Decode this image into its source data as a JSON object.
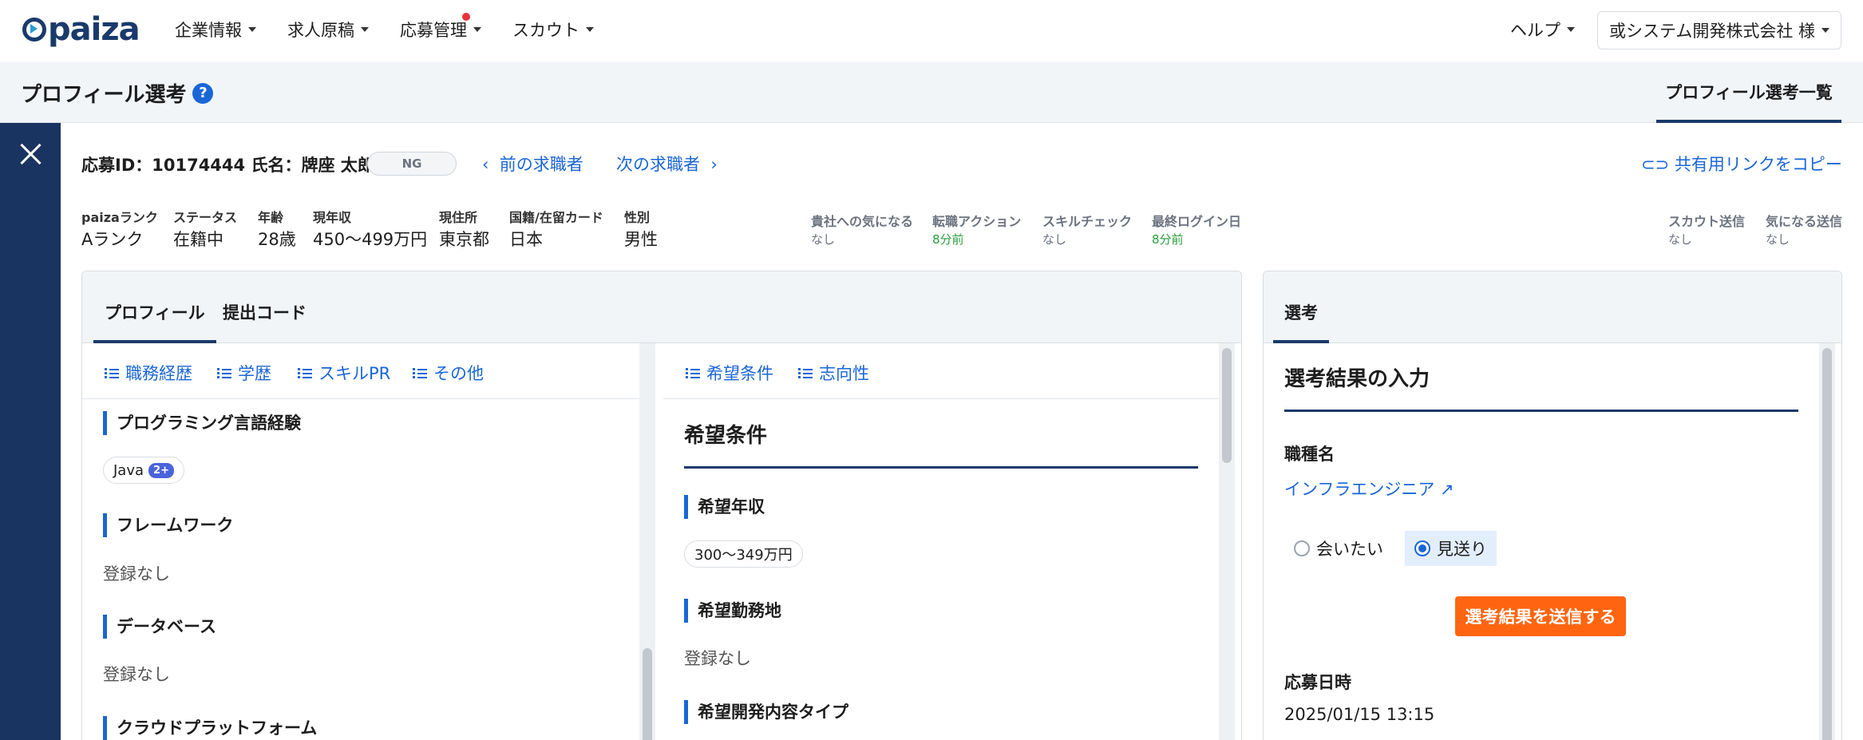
{
  "brand": {
    "name": "paiza"
  },
  "nav": {
    "items": [
      {
        "label": "企業情報"
      },
      {
        "label": "求人原稿"
      },
      {
        "label": "応募管理"
      },
      {
        "label": "スカウト"
      }
    ],
    "help": "ヘルプ",
    "company": "或システム開発株式会社 様"
  },
  "page": {
    "title": "プロフィール選考",
    "tab": "プロフィール選考一覧"
  },
  "applicant": {
    "id_name": "応募ID：10174444  氏名：牌座 太郎",
    "status_badge": "NG",
    "prev": "前の求職者",
    "next": "次の求職者",
    "copy_link": "共有用リンクをコピー"
  },
  "info": [
    {
      "label": "paizaランク",
      "value": "Aランク"
    },
    {
      "label": "ステータス",
      "value": "在籍中"
    },
    {
      "label": "年齢",
      "value": "28歳"
    },
    {
      "label": "現年収",
      "value": "450〜499万円"
    },
    {
      "label": "現住所",
      "value": "東京都"
    },
    {
      "label": "国籍/在留カード",
      "value": "日本"
    },
    {
      "label": "性別",
      "value": "男性"
    }
  ],
  "activity": [
    {
      "label": "貴社への気になる",
      "value": "なし"
    },
    {
      "label": "転職アクション",
      "value": "8分前"
    },
    {
      "label": "スキルチェック",
      "value": "なし"
    },
    {
      "label": "最終ログイン日",
      "value": "8分前"
    },
    {
      "label": "スカウト送信",
      "value": "なし"
    },
    {
      "label": "気になる送信",
      "value": "なし"
    }
  ],
  "profile_panel": {
    "tabs": [
      "プロフィール",
      "提出コード"
    ],
    "left_nav": [
      "職務経歴",
      "学歴",
      "スキルPR",
      "その他"
    ],
    "right_nav": [
      "希望条件",
      "志向性"
    ],
    "sections_left": [
      {
        "title": "プログラミング言語経験"
      },
      {
        "title": "フレームワーク",
        "value": "登録なし"
      },
      {
        "title": "データベース",
        "value": "登録なし"
      },
      {
        "title": "クラウドプラットフォーム"
      }
    ],
    "lang_chip": {
      "label": "Java",
      "badge": "2+"
    },
    "right_title": "希望条件",
    "sections_right": [
      {
        "title": "希望年収",
        "value": "300〜349万円"
      },
      {
        "title": "希望勤務地",
        "value": "登録なし"
      },
      {
        "title": "希望開発内容タイプ"
      }
    ]
  },
  "selection_panel": {
    "tab": "選考",
    "title": "選考結果の入力",
    "job_label": "職種名",
    "job_link": "インフラエンジニア",
    "options": [
      "会いたい",
      "見送り"
    ],
    "selected": "見送り",
    "submit": "選考結果を送信する",
    "date_label": "応募日時",
    "date_value": "2025/01/15 13:15"
  }
}
